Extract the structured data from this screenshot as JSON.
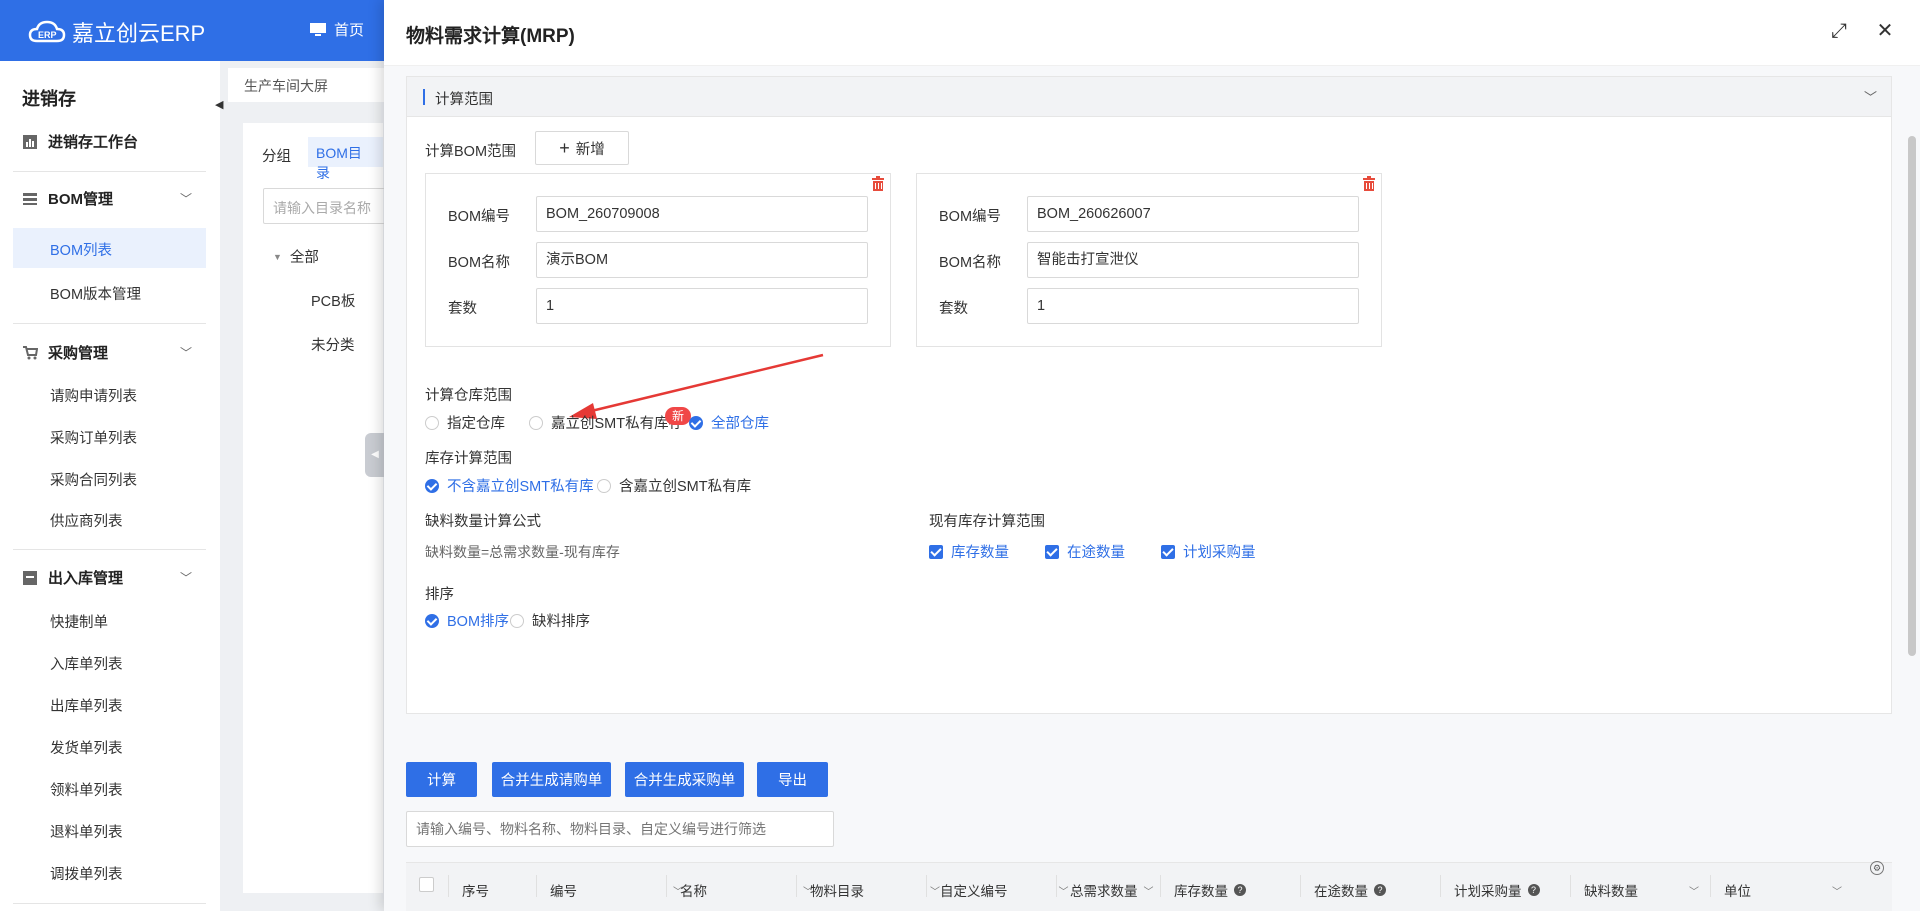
{
  "app": {
    "logo_text": "嘉立创云ERP",
    "home_label": "首页"
  },
  "sidebar": {
    "module_title": "进销存",
    "workbench": "进销存工作台",
    "groups": [
      {
        "label": "BOM管理",
        "items": [
          "BOM列表",
          "BOM版本管理"
        ]
      },
      {
        "label": "采购管理",
        "items": [
          "请购申请列表",
          "采购订单列表",
          "采购合同列表",
          "供应商列表"
        ]
      },
      {
        "label": "出入库管理",
        "items": [
          "快捷制单",
          "入库单列表",
          "出库单列表",
          "发货单列表",
          "领料单列表",
          "退料单列表",
          "调拨单列表"
        ]
      }
    ],
    "active_item": "BOM列表"
  },
  "tabbar": {
    "tab": "生产车间大屏"
  },
  "leftpanel": {
    "group_label": "分组",
    "group_tab": "BOM目录",
    "search_placeholder": "请输入目录名称",
    "tree": [
      "全部",
      "PCB板",
      "未分类"
    ]
  },
  "drawer": {
    "title": "物料需求计算(MRP)",
    "section_title": "计算范围",
    "bom_range_label": "计算BOM范围",
    "add_button": "新增",
    "bom_cards": [
      {
        "code_label": "BOM编号",
        "code": "BOM_260709008",
        "name_label": "BOM名称",
        "name": "演示BOM",
        "qty_label": "套数",
        "qty": "1"
      },
      {
        "code_label": "BOM编号",
        "code": "BOM_260626007",
        "name_label": "BOM名称",
        "name": "智能击打宣泄仪",
        "qty_label": "套数",
        "qty": "1"
      }
    ],
    "warehouse_range": {
      "label": "计算仓库范围",
      "options": [
        "指定仓库",
        "嘉立创SMT私有库存",
        "全部仓库"
      ],
      "selected": "全部仓库",
      "new_badge": "新"
    },
    "stock_range": {
      "label": "库存计算范围",
      "options": [
        "不含嘉立创SMT私有库",
        "含嘉立创SMT私有库"
      ],
      "selected": "不含嘉立创SMT私有库"
    },
    "shortage_formula": {
      "label": "缺料数量计算公式",
      "text": "缺料数量=总需求数量-现有库存"
    },
    "current_stock_range": {
      "label": "现有库存计算范围",
      "checks": [
        "库存数量",
        "在途数量",
        "计划采购量"
      ]
    },
    "sort": {
      "label": "排序",
      "options": [
        "BOM排序",
        "缺料排序"
      ],
      "selected": "BOM排序"
    },
    "actions": [
      "计算",
      "合并生成请购单",
      "合并生成采购单",
      "导出"
    ],
    "filter_placeholder": "请输入编号、物料名称、物料目录、自定义编号进行筛选",
    "columns": [
      "序号",
      "编号",
      "名称",
      "物料目录",
      "自定义编号",
      "总需求数量",
      "库存数量",
      "在途数量",
      "计划采购量",
      "缺料数量",
      "单位"
    ]
  }
}
